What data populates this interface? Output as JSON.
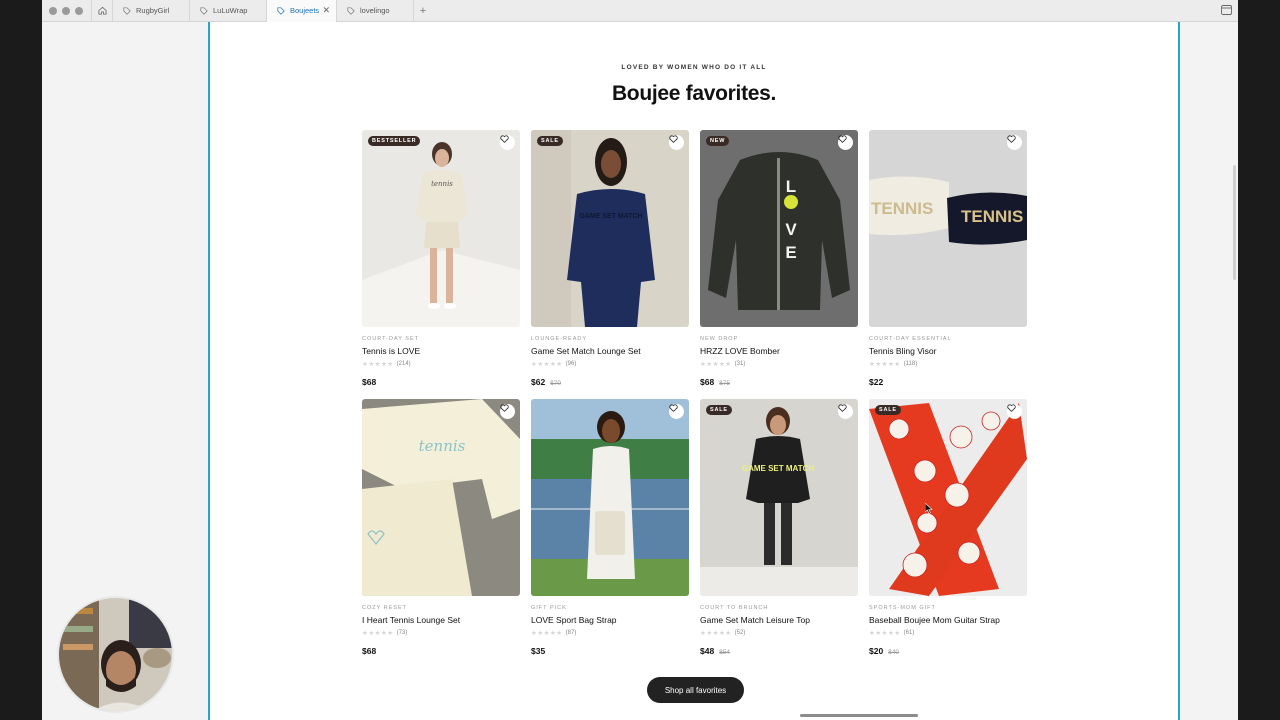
{
  "browser": {
    "tabs": [
      {
        "label": "RugbyGirl"
      },
      {
        "label": "LuLuWrap"
      },
      {
        "label": "Boujeets"
      },
      {
        "label": "lovelingo"
      }
    ],
    "add_tab": "+"
  },
  "section": {
    "eyebrow": "LOVED BY WOMEN WHO DO IT ALL",
    "title": "Boujee favorites."
  },
  "products": [
    {
      "badge": "BESTSELLER",
      "category": "COURT-DAY SET",
      "name": "Tennis is LOVE",
      "stars": "★★★★★",
      "reviews": "(214)",
      "price": "$68",
      "was": ""
    },
    {
      "badge": "SALE",
      "category": "LOUNGE-READY",
      "name": "Game Set Match Lounge Set",
      "stars": "★★★★★",
      "reviews": "(96)",
      "price": "$62",
      "was": "$70"
    },
    {
      "badge": "NEW",
      "category": "NEW DROP",
      "name": "HRZZ LOVE Bomber",
      "stars": "★★★★★",
      "reviews": "(31)",
      "price": "$68",
      "was": "$75"
    },
    {
      "badge": "",
      "category": "COURT-DAY ESSENTIAL",
      "name": "Tennis Bling Visor",
      "stars": "★★★★★",
      "reviews": "(118)",
      "price": "$22",
      "was": ""
    },
    {
      "badge": "",
      "category": "COZY RESET",
      "name": "I Heart Tennis Lounge Set",
      "stars": "★★★★★",
      "reviews": "(73)",
      "price": "$68",
      "was": ""
    },
    {
      "badge": "",
      "category": "GIFT PICK",
      "name": "LOVE Sport Bag Strap",
      "stars": "★★★★★",
      "reviews": "(87)",
      "price": "$35",
      "was": ""
    },
    {
      "badge": "SALE",
      "category": "COURT TO BRUNCH",
      "name": "Game Set Match Leisure Top",
      "stars": "★★★★★",
      "reviews": "(52)",
      "price": "$48",
      "was": "$54"
    },
    {
      "badge": "SALE",
      "category": "SPORTS-MOM GIFT",
      "name": "Baseball Boujee Mom Guitar Strap",
      "stars": "★★★★★",
      "reviews": "(61)",
      "price": "$20",
      "was": "$40"
    }
  ],
  "art": {
    "p0": {
      "letters": "tennis"
    },
    "p1": {
      "letters": "GAME SET MATCH"
    },
    "p2": {
      "letters": "LOVE"
    },
    "p3": {
      "letters": "TENNIS"
    },
    "p4": {
      "letters": "tennis"
    },
    "p6": {
      "letters": "GAME SET MATCH"
    }
  },
  "cta": {
    "label": "Shop all favorites"
  },
  "colors": {
    "accent_border": "#2aa3d3",
    "badge_bg": "#3a2a25",
    "button_bg": "#222222"
  }
}
